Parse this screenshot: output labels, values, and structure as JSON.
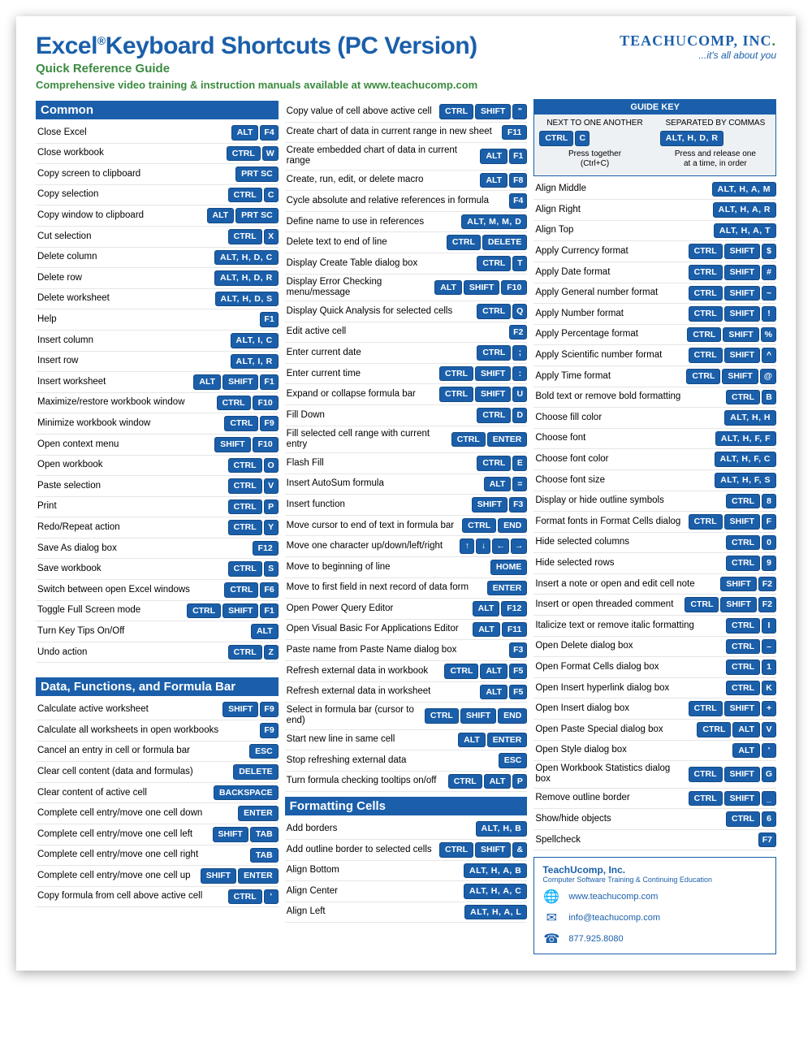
{
  "header": {
    "titleA": "Excel",
    "titleB": "Keyboard Shortcuts",
    "version": "(PC Version)",
    "subtitle": "Quick Reference Guide",
    "training": "Comprehensive video training & instruction manuals available at www.teachucomp.com",
    "brand": "TEACHUCOMP, INC.",
    "tag": "...it's all about you"
  },
  "guideKey": {
    "title": "GUIDE KEY",
    "leftLabel": "NEXT TO ONE ANOTHER",
    "leftKeys": [
      "CTRL",
      "C"
    ],
    "leftDesc": "Press together\n(Ctrl+C)",
    "rightLabel": "SEPARATED BY COMMAS",
    "rightKeys": [
      "ALT, H, D, R"
    ],
    "rightDesc": "Press and release one\nat a time, in order"
  },
  "sections": {
    "common": "Common",
    "dfb": "Data, Functions, and Formula Bar",
    "fmt": "Formatting Cells"
  },
  "col1a": [
    {
      "l": "Close Excel",
      "k": [
        "ALT",
        "F4"
      ]
    },
    {
      "l": "Close workbook",
      "k": [
        "CTRL",
        "W"
      ]
    },
    {
      "l": "Copy screen to clipboard",
      "k": [
        "PRT SC"
      ]
    },
    {
      "l": "Copy selection",
      "k": [
        "CTRL",
        "C"
      ]
    },
    {
      "l": "Copy window to clipboard",
      "k": [
        "ALT",
        "PRT SC"
      ]
    },
    {
      "l": "Cut selection",
      "k": [
        "CTRL",
        "X"
      ]
    },
    {
      "l": "Delete column",
      "k": [
        "ALT, H, D, C"
      ]
    },
    {
      "l": "Delete row",
      "k": [
        "ALT, H, D, R"
      ]
    },
    {
      "l": "Delete worksheet",
      "k": [
        "ALT, H, D, S"
      ]
    },
    {
      "l": "Help",
      "k": [
        "F1"
      ]
    },
    {
      "l": "Insert column",
      "k": [
        "ALT, I, C"
      ]
    },
    {
      "l": "Insert row",
      "k": [
        "ALT, I, R"
      ]
    },
    {
      "l": "Insert worksheet",
      "k": [
        "ALT",
        "SHIFT",
        "F1"
      ]
    },
    {
      "l": "Maximize/restore workbook window",
      "k": [
        "CTRL",
        "F10"
      ]
    },
    {
      "l": "Minimize workbook window",
      "k": [
        "CTRL",
        "F9"
      ]
    },
    {
      "l": "Open context menu",
      "k": [
        "SHIFT",
        "F10"
      ]
    },
    {
      "l": "Open workbook",
      "k": [
        "CTRL",
        "O"
      ]
    },
    {
      "l": "Paste selection",
      "k": [
        "CTRL",
        "V"
      ]
    },
    {
      "l": "Print",
      "k": [
        "CTRL",
        "P"
      ]
    },
    {
      "l": "Redo/Repeat action",
      "k": [
        "CTRL",
        "Y"
      ]
    },
    {
      "l": "Save As dialog box",
      "k": [
        "F12"
      ]
    },
    {
      "l": "Save workbook",
      "k": [
        "CTRL",
        "S"
      ]
    },
    {
      "l": "Switch between open Excel windows",
      "k": [
        "CTRL",
        "F6"
      ]
    },
    {
      "l": "Toggle Full Screen mode",
      "k": [
        "CTRL",
        "SHIFT",
        "F1"
      ]
    },
    {
      "l": "Turn Key Tips On/Off",
      "k": [
        "ALT"
      ]
    },
    {
      "l": "Undo action",
      "k": [
        "CTRL",
        "Z"
      ]
    }
  ],
  "col1b": [
    {
      "l": "Calculate active worksheet",
      "k": [
        "SHIFT",
        "F9"
      ]
    },
    {
      "l": "Calculate all worksheets in open workbooks",
      "k": [
        "F9"
      ]
    },
    {
      "l": "Cancel an entry in cell or formula bar",
      "k": [
        "ESC"
      ]
    },
    {
      "l": "Clear cell content (data and formulas)",
      "k": [
        "DELETE"
      ]
    },
    {
      "l": "Clear content of active cell",
      "k": [
        "BACKSPACE"
      ]
    },
    {
      "l": "Complete cell entry/move one cell down",
      "k": [
        "ENTER"
      ]
    },
    {
      "l": "Complete cell entry/move one cell left",
      "k": [
        "SHIFT",
        "TAB"
      ]
    },
    {
      "l": "Complete cell entry/move one cell right",
      "k": [
        "TAB"
      ]
    },
    {
      "l": "Complete cell entry/move one cell up",
      "k": [
        "SHIFT",
        "ENTER"
      ]
    },
    {
      "l": "Copy formula from cell above active cell",
      "k": [
        "CTRL",
        "'"
      ]
    }
  ],
  "col2a": [
    {
      "l": "Copy value of cell above active cell",
      "k": [
        "CTRL",
        "SHIFT",
        "\""
      ]
    },
    {
      "l": "Create chart of data in current range in new sheet",
      "k": [
        "F11"
      ]
    },
    {
      "l": "Create embedded chart of data in current range",
      "k": [
        "ALT",
        "F1"
      ]
    },
    {
      "l": "Create, run, edit, or delete macro",
      "k": [
        "ALT",
        "F8"
      ]
    },
    {
      "l": "Cycle absolute and relative references in formula",
      "k": [
        "F4"
      ]
    },
    {
      "l": "Define name to use in references",
      "k": [
        "ALT, M, M, D"
      ]
    },
    {
      "l": "Delete text to end of line",
      "k": [
        "CTRL",
        "DELETE"
      ]
    },
    {
      "l": "Display Create Table dialog box",
      "k": [
        "CTRL",
        "T"
      ]
    },
    {
      "l": "Display Error Checking menu/message",
      "k": [
        "ALT",
        "SHIFT",
        "F10"
      ]
    },
    {
      "l": "Display Quick Analysis for selected cells",
      "k": [
        "CTRL",
        "Q"
      ]
    },
    {
      "l": "Edit active cell",
      "k": [
        "F2"
      ]
    },
    {
      "l": "Enter current date",
      "k": [
        "CTRL",
        ";"
      ]
    },
    {
      "l": "Enter current time",
      "k": [
        "CTRL",
        "SHIFT",
        ":"
      ]
    },
    {
      "l": "Expand or collapse formula bar",
      "k": [
        "CTRL",
        "SHIFT",
        "U"
      ]
    },
    {
      "l": "Fill Down",
      "k": [
        "CTRL",
        "D"
      ]
    },
    {
      "l": "Fill selected cell range with current entry",
      "k": [
        "CTRL",
        "ENTER"
      ]
    },
    {
      "l": "Flash Fill",
      "k": [
        "CTRL",
        "E"
      ]
    },
    {
      "l": "Insert AutoSum formula",
      "k": [
        "ALT",
        "="
      ]
    },
    {
      "l": "Insert function",
      "k": [
        "SHIFT",
        "F3"
      ]
    },
    {
      "l": "Move cursor to end of text in formula bar",
      "k": [
        "CTRL",
        "END"
      ]
    },
    {
      "l": "Move one character up/down/left/right",
      "k": [
        "↑",
        "↓",
        "←",
        "→"
      ]
    },
    {
      "l": "Move to beginning of line",
      "k": [
        "HOME"
      ]
    },
    {
      "l": "Move to first field in next record of data form",
      "k": [
        "ENTER"
      ]
    },
    {
      "l": "Open Power Query Editor",
      "k": [
        "ALT",
        "F12"
      ]
    },
    {
      "l": "Open Visual Basic For Applications Editor",
      "k": [
        "ALT",
        "F11"
      ]
    },
    {
      "l": "Paste name from Paste Name dialog box",
      "k": [
        "F3"
      ]
    },
    {
      "l": "Refresh external data in workbook",
      "k": [
        "CTRL",
        "ALT",
        "F5"
      ]
    },
    {
      "l": "Refresh external data in worksheet",
      "k": [
        "ALT",
        "F5"
      ]
    },
    {
      "l": "Select in formula bar (cursor to end)",
      "k": [
        "CTRL",
        "SHIFT",
        "END"
      ]
    },
    {
      "l": "Start new line in same cell",
      "k": [
        "ALT",
        "ENTER"
      ]
    },
    {
      "l": "Stop refreshing external data",
      "k": [
        "ESC"
      ]
    },
    {
      "l": "Turn formula checking tooltips on/off",
      "k": [
        "CTRL",
        "ALT",
        "P"
      ]
    }
  ],
  "col2b": [
    {
      "l": "Add borders",
      "k": [
        "ALT, H, B"
      ]
    },
    {
      "l": "Add outline border to selected cells",
      "k": [
        "CTRL",
        "SHIFT",
        "&"
      ]
    },
    {
      "l": "Align Bottom",
      "k": [
        "ALT, H, A, B"
      ]
    },
    {
      "l": "Align Center",
      "k": [
        "ALT, H, A, C"
      ]
    },
    {
      "l": "Align Left",
      "k": [
        "ALT, H, A, L"
      ]
    }
  ],
  "col3": [
    {
      "l": "Align Middle",
      "k": [
        "ALT, H, A, M"
      ]
    },
    {
      "l": "Align Right",
      "k": [
        "ALT, H, A, R"
      ]
    },
    {
      "l": "Align Top",
      "k": [
        "ALT, H, A, T"
      ]
    },
    {
      "l": "Apply Currency format",
      "k": [
        "CTRL",
        "SHIFT",
        "$"
      ]
    },
    {
      "l": "Apply Date format",
      "k": [
        "CTRL",
        "SHIFT",
        "#"
      ]
    },
    {
      "l": "Apply General number format",
      "k": [
        "CTRL",
        "SHIFT",
        "~"
      ]
    },
    {
      "l": "Apply Number format",
      "k": [
        "CTRL",
        "SHIFT",
        "!"
      ]
    },
    {
      "l": "Apply Percentage format",
      "k": [
        "CTRL",
        "SHIFT",
        "%"
      ]
    },
    {
      "l": "Apply Scientific number format",
      "k": [
        "CTRL",
        "SHIFT",
        "^"
      ]
    },
    {
      "l": "Apply Time format",
      "k": [
        "CTRL",
        "SHIFT",
        "@"
      ]
    },
    {
      "l": "Bold text or remove bold formatting",
      "k": [
        "CTRL",
        "B"
      ]
    },
    {
      "l": "Choose fill color",
      "k": [
        "ALT, H, H"
      ]
    },
    {
      "l": "Choose font",
      "k": [
        "ALT, H, F, F"
      ]
    },
    {
      "l": "Choose font color",
      "k": [
        "ALT, H, F, C"
      ]
    },
    {
      "l": "Choose font size",
      "k": [
        "ALT, H, F, S"
      ]
    },
    {
      "l": "Display or hide outline symbols",
      "k": [
        "CTRL",
        "8"
      ]
    },
    {
      "l": "Format fonts in Format Cells dialog",
      "k": [
        "CTRL",
        "SHIFT",
        "F"
      ]
    },
    {
      "l": "Hide selected columns",
      "k": [
        "CTRL",
        "0"
      ]
    },
    {
      "l": "Hide selected rows",
      "k": [
        "CTRL",
        "9"
      ]
    },
    {
      "l": "Insert a note or open and edit cell note",
      "k": [
        "SHIFT",
        "F2"
      ]
    },
    {
      "l": "Insert or open threaded comment",
      "k": [
        "CTRL",
        "SHIFT",
        "F2"
      ]
    },
    {
      "l": "Italicize text or remove italic formatting",
      "k": [
        "CTRL",
        "I"
      ]
    },
    {
      "l": "Open Delete dialog box",
      "k": [
        "CTRL",
        "–"
      ]
    },
    {
      "l": "Open Format Cells dialog box",
      "k": [
        "CTRL",
        "1"
      ]
    },
    {
      "l": "Open Insert hyperlink dialog box",
      "k": [
        "CTRL",
        "K"
      ]
    },
    {
      "l": "Open Insert dialog box",
      "k": [
        "CTRL",
        "SHIFT",
        "+"
      ]
    },
    {
      "l": "Open Paste Special dialog box",
      "k": [
        "CTRL",
        "ALT",
        "V"
      ]
    },
    {
      "l": "Open Style dialog box",
      "k": [
        "ALT",
        "'"
      ]
    },
    {
      "l": "Open Workbook Statistics dialog box",
      "k": [
        "CTRL",
        "SHIFT",
        "G"
      ]
    },
    {
      "l": "Remove outline border",
      "k": [
        "CTRL",
        "SHIFT",
        "_"
      ]
    },
    {
      "l": "Show/hide objects",
      "k": [
        "CTRL",
        "6"
      ]
    },
    {
      "l": "Spellcheck",
      "k": [
        "F7"
      ]
    }
  ],
  "contact": {
    "title": "TeachUcomp, Inc.",
    "sub": "Computer Software Training & Continuing Education",
    "web": "www.teachucomp.com",
    "email": "info@teachucomp.com",
    "phone": "877.925.8080"
  }
}
